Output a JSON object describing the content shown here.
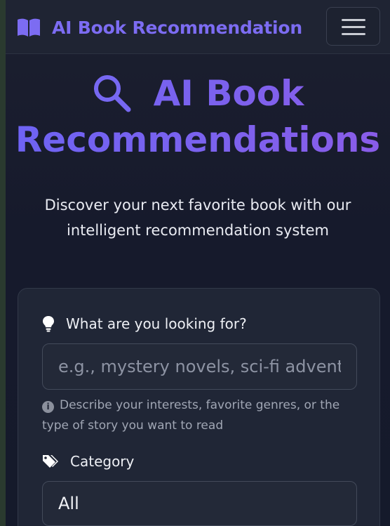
{
  "navbar": {
    "brand_text": "AI Book Recommendation",
    "brand_icon": "book-open-icon",
    "menu_icon": "hamburger-menu-icon"
  },
  "hero": {
    "icon": "search-icon",
    "title_line1": "AI Book",
    "title_line2": "Recommendations",
    "subtitle": "Discover your next favorite book with our intelligent recommendation system"
  },
  "form": {
    "query_label": "What are you looking for?",
    "query_icon": "lightbulb-icon",
    "query_placeholder": "e.g., mystery novels, sci-fi adventures",
    "query_value": "",
    "help_icon": "info-icon",
    "help_text": "Describe your interests, favorite genres, or the type of story you want to read",
    "category_label": "Category",
    "category_icon": "tags-icon",
    "category_value": "All"
  },
  "colors": {
    "accent": "#7c6cf2",
    "background": "#161a2c",
    "card": "#202636"
  }
}
